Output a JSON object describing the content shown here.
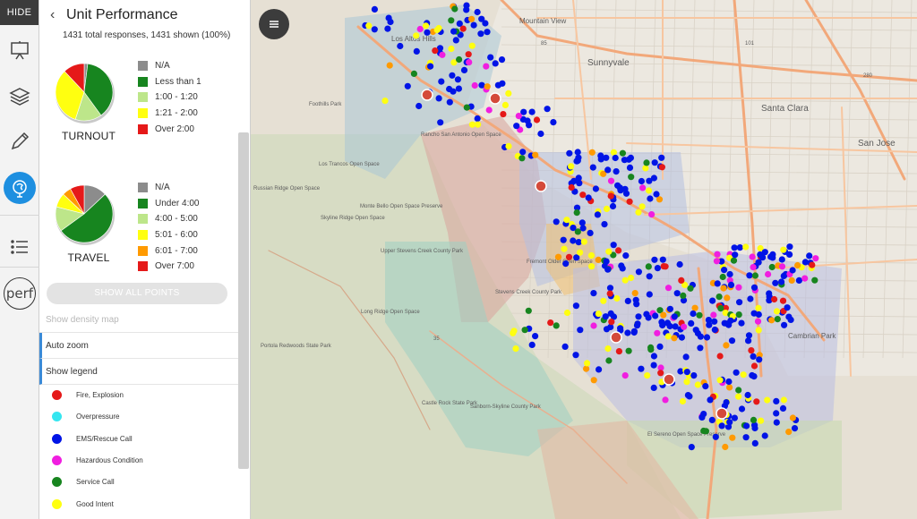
{
  "header": {
    "hide_label": "HIDE",
    "title": "Unit Performance",
    "summary": "1431 total responses, 1431 shown (100%)"
  },
  "turnout": {
    "label": "TURNOUT",
    "legend": [
      {
        "label": "N/A",
        "color": "#8c8c8c"
      },
      {
        "label": "Less than 1",
        "color": "#17851f"
      },
      {
        "label": "1:00 - 1:20",
        "color": "#bde68a"
      },
      {
        "label": "1:21 - 2:00",
        "color": "#ffff10"
      },
      {
        "label": "Over 2:00",
        "color": "#e51919"
      }
    ],
    "slices": [
      0.02,
      0.38,
      0.15,
      0.33,
      0.12
    ]
  },
  "travel": {
    "label": "TRAVEL",
    "legend": [
      {
        "label": "N/A",
        "color": "#8c8c8c"
      },
      {
        "label": "Under 4:00",
        "color": "#17851f"
      },
      {
        "label": "4:00 - 5:00",
        "color": "#bde68a"
      },
      {
        "label": "5:01 - 6:00",
        "color": "#ffff10"
      },
      {
        "label": "6:01 - 7:00",
        "color": "#ff9a00"
      },
      {
        "label": "Over 7:00",
        "color": "#e51919"
      }
    ],
    "slices": [
      0.13,
      0.52,
      0.14,
      0.08,
      0.05,
      0.08
    ]
  },
  "controls": {
    "show_all_points": "SHOW ALL POINTS",
    "show_density_map": "Show density map",
    "auto_zoom": "Auto zoom",
    "show_legend": "Show legend"
  },
  "incident_legend": [
    {
      "label": "Fire, Explosion",
      "color": "#e51919"
    },
    {
      "label": "Overpressure",
      "color": "#35e6f0"
    },
    {
      "label": "EMS/Rescue Call",
      "color": "#0014e6"
    },
    {
      "label": "Hazardous Condition",
      "color": "#f01ee0"
    },
    {
      "label": "Service Call",
      "color": "#17851f"
    },
    {
      "label": "Good Intent",
      "color": "#ffff10"
    }
  ],
  "map_labels": {
    "mountain_view": "Mountain View",
    "sunnyvale": "Sunnyvale",
    "santa_clara": "Santa Clara",
    "san_jose": "San Jose",
    "los_altos_hills": "Los Altos Hills",
    "rancho": "Rancho San Antonio Open Space",
    "foothills_park": "Foothills Park",
    "los_trancos": "Los Trancos Open Space",
    "russian_ridge": "Russian Ridge Open Space",
    "monte_bello": "Monte Bello Open Space Preserve",
    "skyline_ridge": "Skyline Ridge Open Space",
    "upper_stevens": "Upper Stevens Creek County Park",
    "fremont_older": "Fremont Older Open Space",
    "stevens_creek": "Stevens Creek County Park",
    "long_ridge": "Long Ridge Open Space",
    "portola": "Portola Redwoods State Park",
    "sanborn": "Sanborn-Skyline County Park",
    "castle_rock": "Castle Rock State Park",
    "el_sereno": "El Sereno Open Space Preserve",
    "cambrian_park": "Cambrian Park",
    "hwy_85": "85",
    "hwy_101": "101",
    "hwy_280": "280",
    "hwy_35": "35"
  }
}
